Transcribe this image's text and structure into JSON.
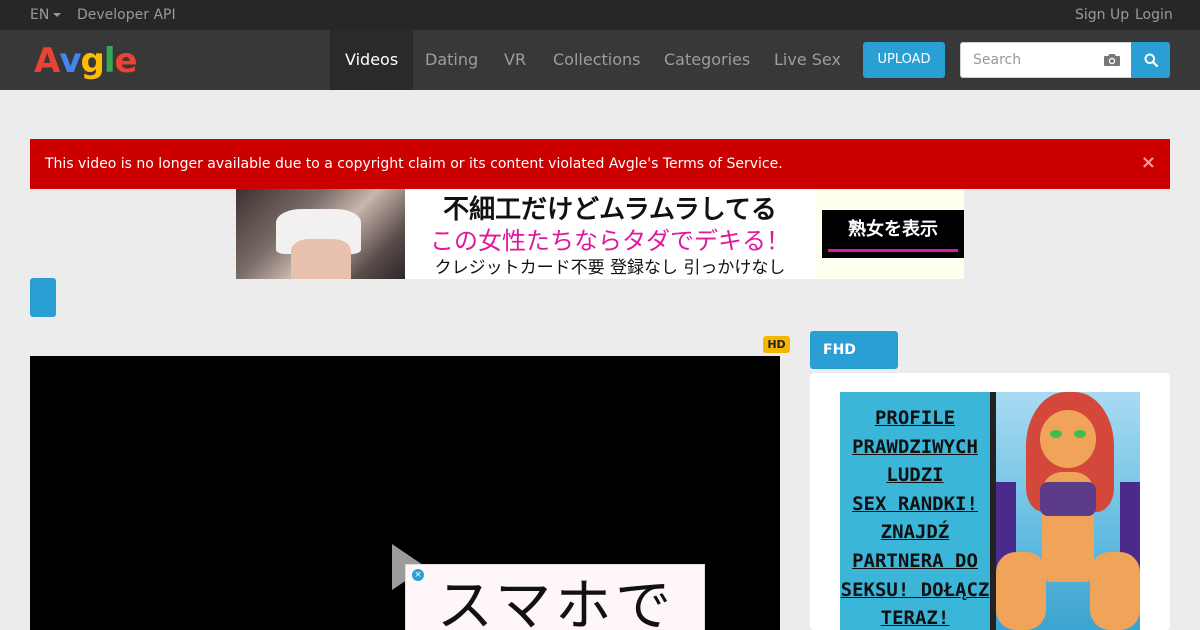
{
  "topbar": {
    "language": "EN",
    "developer_api": "Developer API",
    "sign_up": "Sign Up",
    "login": "Login"
  },
  "brand": {
    "logo_letters": [
      "A",
      "v",
      "g",
      "l",
      "e"
    ],
    "logo_colors": [
      "#ea4335",
      "#4285f4",
      "#fbbc05",
      "#34a853",
      "#ea4335"
    ]
  },
  "nav": {
    "items": [
      "Videos",
      "Dating",
      "VR",
      "Collections",
      "Categories",
      "Live Sex"
    ],
    "active": "Videos",
    "upload": "UPLOAD",
    "search_placeholder": "Search"
  },
  "alert": {
    "message": "This video is no longer available due to a copyright claim or its content violated Avgle's Terms of Service.",
    "close": "×"
  },
  "top_ad": {
    "line1": "不細工だけどムラムラしてる",
    "line2": "この女性たちならタダでデキる！",
    "line3": "クレジットカード不要 登録なし 引っかけなし",
    "cta": "熟女を表示"
  },
  "video": {
    "quality_badge": "HD",
    "overlay_ad_text": "スマホで"
  },
  "sidebar": {
    "tab": "FHD",
    "ad_lines": [
      "PROFILE",
      "PRAWDZIWYCH",
      "LUDZI",
      "SEX RANDKI!",
      "ZNAJDŹ",
      "PARTNERA DO",
      "SEKSU! DOŁĄCZ",
      "TERAZ!"
    ]
  },
  "colors": {
    "accent": "#2a9fd6",
    "alert": "#cc0000",
    "navbar": "#383838",
    "topbar": "#272727",
    "hd_badge": "#f5b800"
  }
}
